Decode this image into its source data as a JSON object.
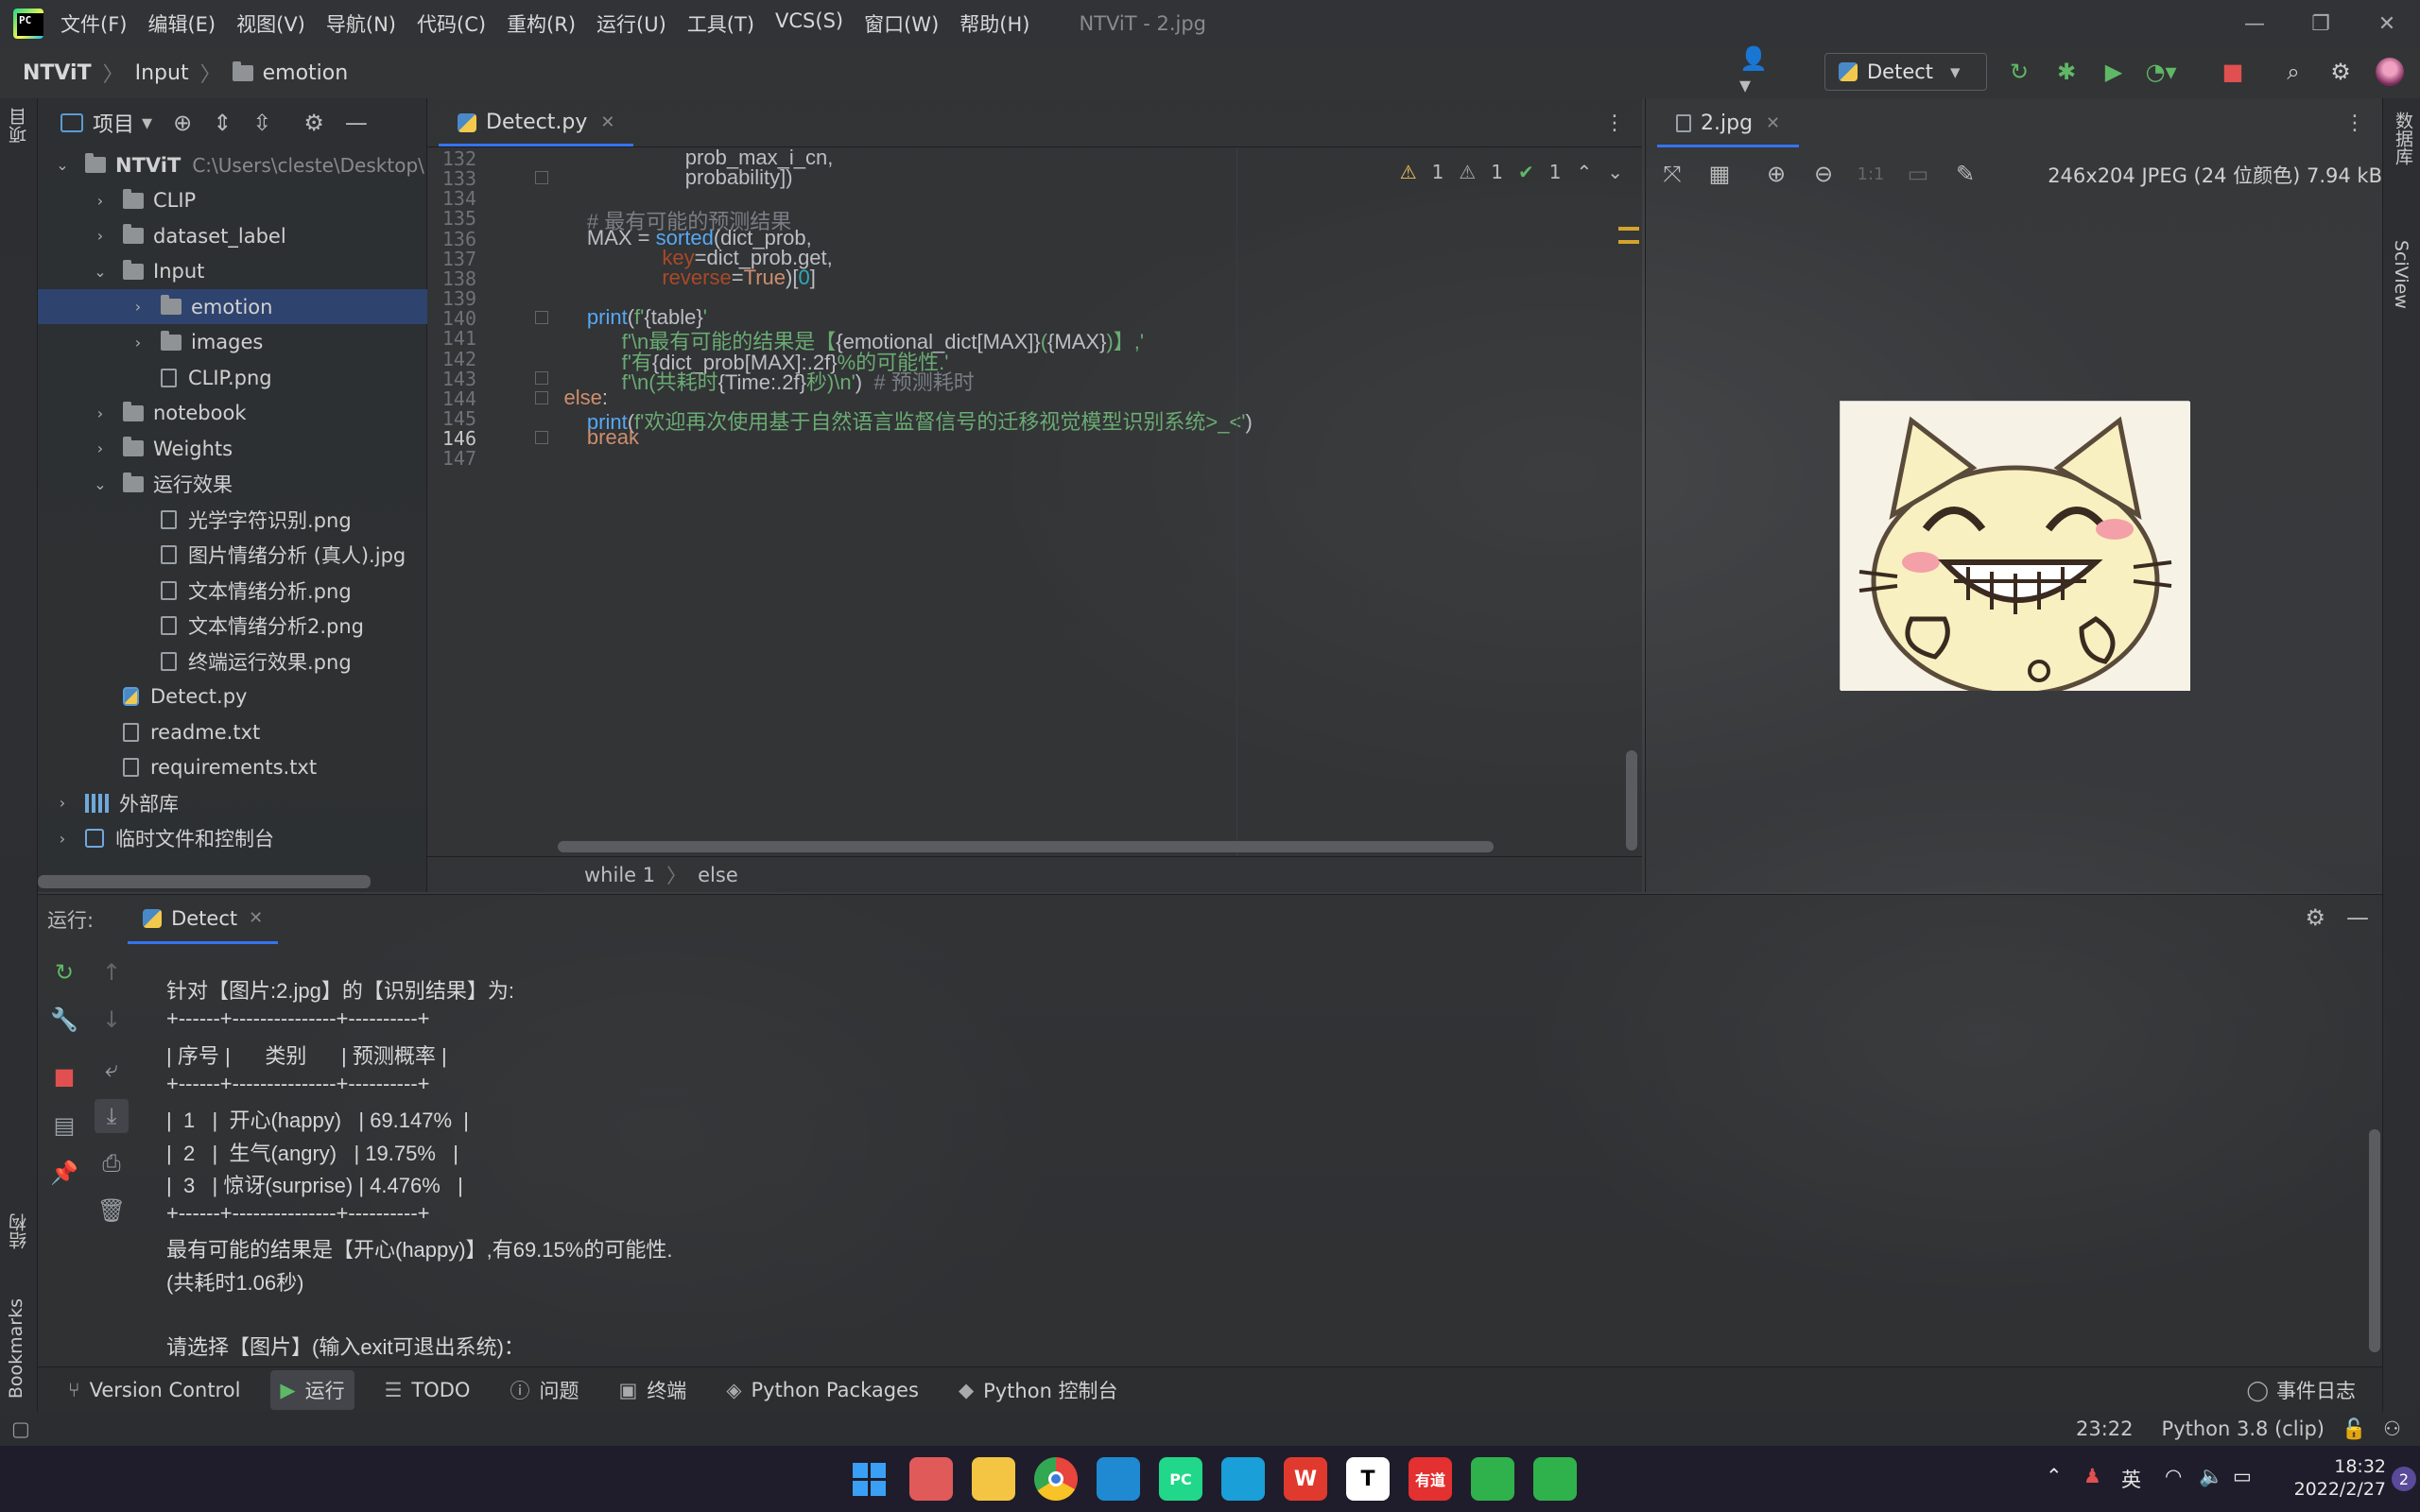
{
  "app": {
    "window_title": "NTViT - 2.jpg"
  },
  "menu": [
    "文件(F)",
    "编辑(E)",
    "视图(V)",
    "导航(N)",
    "代码(C)",
    "重构(R)",
    "运行(U)",
    "工具(T)",
    "VCS(S)",
    "窗口(W)",
    "帮助(H)"
  ],
  "breadcrumb": [
    "NTViT",
    "Input",
    "emotion"
  ],
  "run_config": "Detect",
  "left_strip": {
    "project": "项目",
    "structure": "结构",
    "bookmarks": "Bookmarks"
  },
  "right_strip": {
    "database": "数据库",
    "sciview": "SciView"
  },
  "project": {
    "header": "项目",
    "root_name": "NTViT",
    "root_path": "C:\\Users\\cleste\\Desktop\\",
    "tree": [
      {
        "label": "CLIP",
        "kind": "folder",
        "depth": 1,
        "state": "collapsed"
      },
      {
        "label": "dataset_label",
        "kind": "folder",
        "depth": 1,
        "state": "collapsed"
      },
      {
        "label": "Input",
        "kind": "folder",
        "depth": 1,
        "state": "expanded"
      },
      {
        "label": "emotion",
        "kind": "folder",
        "depth": 2,
        "state": "collapsed",
        "selected": true
      },
      {
        "label": "images",
        "kind": "folder",
        "depth": 2,
        "state": "collapsed"
      },
      {
        "label": "CLIP.png",
        "kind": "image",
        "depth": 2
      },
      {
        "label": "notebook",
        "kind": "folder",
        "depth": 1,
        "state": "collapsed"
      },
      {
        "label": "Weights",
        "kind": "folder",
        "depth": 1,
        "state": "collapsed"
      },
      {
        "label": "运行效果",
        "kind": "folder",
        "depth": 1,
        "state": "expanded"
      },
      {
        "label": "光学字符识别.png",
        "kind": "image",
        "depth": 2
      },
      {
        "label": "图片情绪分析 (真人).jpg",
        "kind": "image",
        "depth": 2
      },
      {
        "label": "文本情绪分析.png",
        "kind": "image",
        "depth": 2
      },
      {
        "label": "文本情绪分析2.png",
        "kind": "image",
        "depth": 2
      },
      {
        "label": "终端运行效果.png",
        "kind": "image",
        "depth": 2
      },
      {
        "label": "Detect.py",
        "kind": "py",
        "depth": 1
      },
      {
        "label": "readme.txt",
        "kind": "txt",
        "depth": 1
      },
      {
        "label": "requirements.txt",
        "kind": "txt",
        "depth": 1
      },
      {
        "label": "外部库",
        "kind": "lib",
        "depth": 0,
        "state": "collapsed"
      },
      {
        "label": "临时文件和控制台",
        "kind": "tmp",
        "depth": 0,
        "state": "collapsed"
      }
    ]
  },
  "editor": {
    "tab": "Detect.py",
    "inspections": {
      "warn1": "1",
      "warn2": "1",
      "ok": "1"
    },
    "lines": [
      {
        "n": "132",
        "tokens": [
          {
            "t": "                         prob_max_i_cn,",
            "c": ""
          }
        ]
      },
      {
        "n": "133",
        "tokens": [
          {
            "t": "                         probability])",
            "c": ""
          }
        ]
      },
      {
        "n": "134",
        "tokens": []
      },
      {
        "n": "135",
        "tokens": [
          {
            "t": "        ",
            "c": ""
          },
          {
            "t": "# 最有可能的预测结果",
            "c": "cmt"
          }
        ]
      },
      {
        "n": "136",
        "tokens": [
          {
            "t": "        MAX = ",
            "c": ""
          },
          {
            "t": "sorted",
            "c": "fn"
          },
          {
            "t": "(dict_prob,",
            "c": ""
          }
        ]
      },
      {
        "n": "137",
        "tokens": [
          {
            "t": "                     ",
            "c": ""
          },
          {
            "t": "key",
            "c": "param"
          },
          {
            "t": "=dict_prob.get,",
            "c": ""
          }
        ]
      },
      {
        "n": "138",
        "tokens": [
          {
            "t": "                     ",
            "c": ""
          },
          {
            "t": "reverse",
            "c": "param"
          },
          {
            "t": "=",
            "c": ""
          },
          {
            "t": "True",
            "c": "kw"
          },
          {
            "t": ")[",
            "c": ""
          },
          {
            "t": "0",
            "c": "num"
          },
          {
            "t": "]",
            "c": ""
          }
        ]
      },
      {
        "n": "139",
        "tokens": []
      },
      {
        "n": "140",
        "tokens": [
          {
            "t": "        ",
            "c": ""
          },
          {
            "t": "print",
            "c": "fn"
          },
          {
            "t": "(",
            "c": ""
          },
          {
            "t": "f'",
            "c": "str"
          },
          {
            "t": "{table}",
            "c": ""
          },
          {
            "t": "'",
            "c": "str"
          }
        ]
      },
      {
        "n": "141",
        "tokens": [
          {
            "t": "              ",
            "c": ""
          },
          {
            "t": "f'\\n最有可能的结果是【",
            "c": "str"
          },
          {
            "t": "{emotional_dict[MAX]}",
            "c": ""
          },
          {
            "t": "(",
            "c": "str"
          },
          {
            "t": "{MAX}",
            "c": ""
          },
          {
            "t": ")】,'",
            "c": "str"
          }
        ]
      },
      {
        "n": "142",
        "tokens": [
          {
            "t": "              ",
            "c": ""
          },
          {
            "t": "f'有",
            "c": "str"
          },
          {
            "t": "{dict_prob[MAX]:.2f}",
            "c": ""
          },
          {
            "t": "%的可能性.'",
            "c": "str"
          }
        ]
      },
      {
        "n": "143",
        "tokens": [
          {
            "t": "              ",
            "c": ""
          },
          {
            "t": "f'\\n(共耗时",
            "c": "str"
          },
          {
            "t": "{Time:.2f}",
            "c": ""
          },
          {
            "t": "秒)\\n'",
            "c": "str"
          },
          {
            "t": ")  ",
            "c": ""
          },
          {
            "t": "# 预测耗时",
            "c": "cmt"
          }
        ]
      },
      {
        "n": "144",
        "tokens": [
          {
            "t": "    ",
            "c": ""
          },
          {
            "t": "else",
            "c": "kw"
          },
          {
            "t": ":",
            "c": ""
          }
        ]
      },
      {
        "n": "145",
        "tokens": [
          {
            "t": "        ",
            "c": ""
          },
          {
            "t": "print",
            "c": "fn"
          },
          {
            "t": "(",
            "c": ""
          },
          {
            "t": "f'欢迎再次使用基于自然语言监督信号的迁移视觉模型识别系统>_<'",
            "c": "str"
          },
          {
            "t": ")",
            "c": ""
          }
        ]
      },
      {
        "n": "146",
        "tokens": [
          {
            "t": "        ",
            "c": ""
          },
          {
            "t": "break",
            "c": "kw"
          }
        ]
      },
      {
        "n": "147",
        "tokens": []
      }
    ],
    "code_breadcrumb": [
      "while 1",
      "else"
    ]
  },
  "viewer": {
    "tab": "2.jpg",
    "info": "246x204 JPEG (24 位颜色) 7.94 kB",
    "one_to_one": "1:1"
  },
  "run": {
    "label": "运行:",
    "tab": "Detect",
    "console": [
      "针对【图片:2.jpg】的【识别结果】为:",
      "+------+---------------+----------+",
      "| 序号 |      类别      | 预测概率 |",
      "+------+---------------+----------+",
      "|  1   |  开心(happy)   | 69.147%  |",
      "|  2   |  生气(angry)   | 19.75%   |",
      "|  3   | 惊讶(surprise) | 4.476%   |",
      "+------+---------------+----------+",
      "最有可能的结果是【开心(happy)】,有69.15%的可能性.",
      "(共耗时1.06秒)",
      "",
      "请选择【图片】(输入exit可退出系统)："
    ]
  },
  "bottom_tools": [
    {
      "label": "Version Control",
      "icon": "branch-icon",
      "glyph": "⑂"
    },
    {
      "label": "运行",
      "icon": "run-icon",
      "glyph": "▶",
      "active": true
    },
    {
      "label": "TODO",
      "icon": "list-icon",
      "glyph": "☰"
    },
    {
      "label": "问题",
      "icon": "info-icon",
      "glyph": "ⓘ"
    },
    {
      "label": "终端",
      "icon": "terminal-icon",
      "glyph": "▣"
    },
    {
      "label": "Python Packages",
      "icon": "layers-icon",
      "glyph": "◈"
    },
    {
      "label": "Python 控制台",
      "icon": "python-icon",
      "glyph": "◆"
    }
  ],
  "event_log": "事件日志",
  "status": {
    "position": "23:22",
    "interpreter": "Python 3.8 (clip)"
  },
  "taskbar": {
    "apps": [
      {
        "name": "start-icon",
        "label": "",
        "color": "#2f8cf0"
      },
      {
        "name": "snipping-tool-icon",
        "label": "",
        "color": "#e05a5a"
      },
      {
        "name": "file-explorer-icon",
        "label": "",
        "color": "#f4c542"
      },
      {
        "name": "chrome-icon",
        "label": "",
        "color": "#e8453c"
      },
      {
        "name": "vscode-icon",
        "label": "",
        "color": "#1f8ad2"
      },
      {
        "name": "pycharm-icon",
        "label": "PC",
        "color": "#21d789"
      },
      {
        "name": "edge-icon",
        "label": "",
        "color": "#1a9fd8"
      },
      {
        "name": "wps-icon",
        "label": "W",
        "color": "#e03a2f"
      },
      {
        "name": "typora-icon",
        "label": "T",
        "color": "#ffffff"
      },
      {
        "name": "youdao-icon",
        "label": "有道",
        "color": "#e33030"
      },
      {
        "name": "chat-icon",
        "label": "",
        "color": "#2fb24c"
      },
      {
        "name": "wechat-icon",
        "label": "",
        "color": "#2fb24c"
      }
    ],
    "ime": "英",
    "time": "18:32",
    "date": "2022/2/27",
    "notif_count": "2"
  }
}
